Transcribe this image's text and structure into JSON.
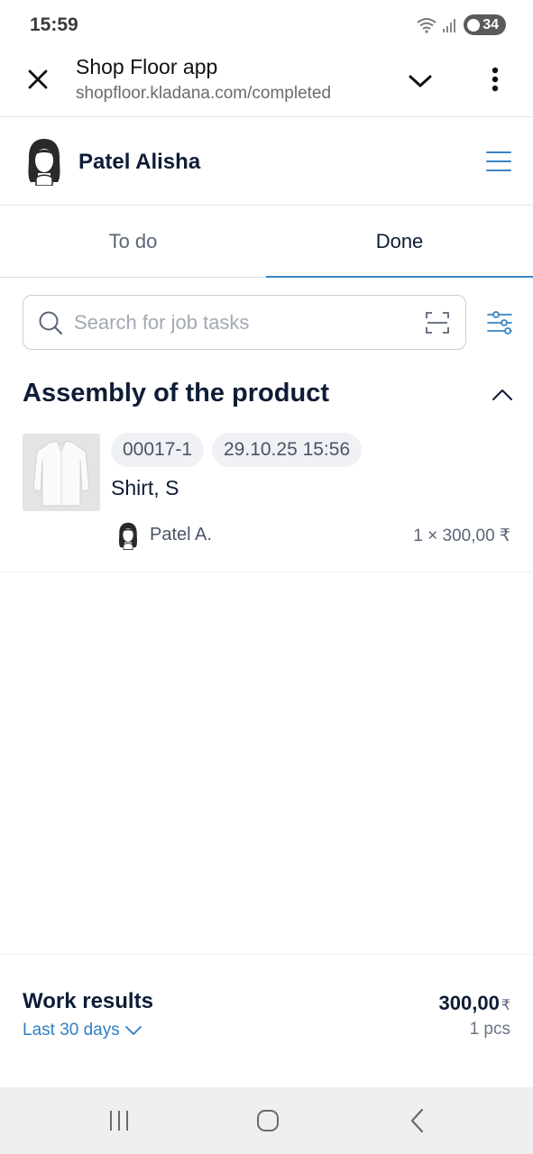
{
  "status_bar": {
    "time": "15:59",
    "battery": "34",
    "icons": [
      "wifi-icon",
      "signal-icon",
      "battery-icon"
    ]
  },
  "browser": {
    "title": "Shop Floor app",
    "url": "shopfloor.kladana.com/completed"
  },
  "user": {
    "name": "Patel Alisha"
  },
  "tabs": [
    {
      "label": "To do",
      "active": false
    },
    {
      "label": "Done",
      "active": true
    }
  ],
  "search": {
    "placeholder": "Search for job tasks",
    "value": ""
  },
  "section": {
    "title": "Assembly of the product",
    "expanded": true
  },
  "tasks": [
    {
      "id": "00017-1",
      "datetime": "29.10.25 15:56",
      "product": "Shirt, S",
      "worker": "Patel A.",
      "qty_price": "1 × 300,00 ₹"
    }
  ],
  "summary": {
    "title": "Work results",
    "period": "Last 30 days",
    "total": "300,00",
    "currency": "₹",
    "pieces": "1 pcs"
  },
  "colors": {
    "accent": "#3a84c4",
    "text_primary": "#0f1c36",
    "text_secondary": "#5b6577"
  }
}
